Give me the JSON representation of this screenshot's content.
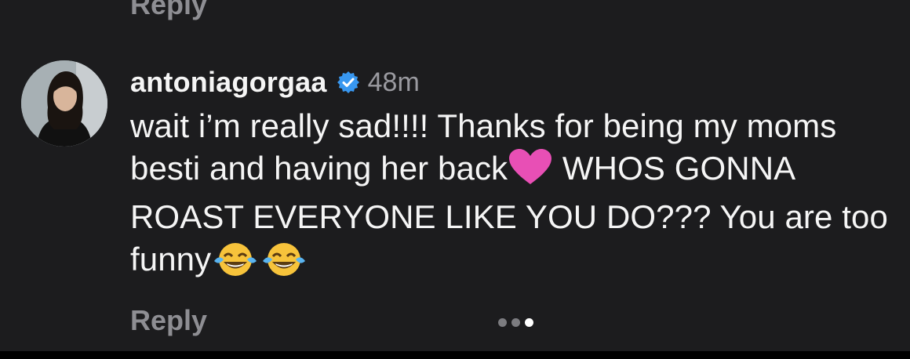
{
  "previous_comment": {
    "reply_label": "Reply"
  },
  "comment": {
    "username": "antoniagorgaa",
    "verified": true,
    "time": "48m",
    "text": {
      "part1": "wait i’m really sad!!!! Thanks for being my moms besti and having her back",
      "part2": " WHOS GONNA ROAST EVERYONE LIKE YOU DO??? You are too funny",
      "emoji_heart": "pink-heart-emoji",
      "emoji_laugh": "tears-of-joy-emoji"
    },
    "reply_label": "Reply"
  },
  "carousel": {
    "count": 3,
    "active_index": 2
  },
  "colors": {
    "background": "#1c1c1e",
    "text": "#f5f5f5",
    "muted": "#8e8e93",
    "verified": "#3897f0",
    "heart": "#e84fb5"
  }
}
